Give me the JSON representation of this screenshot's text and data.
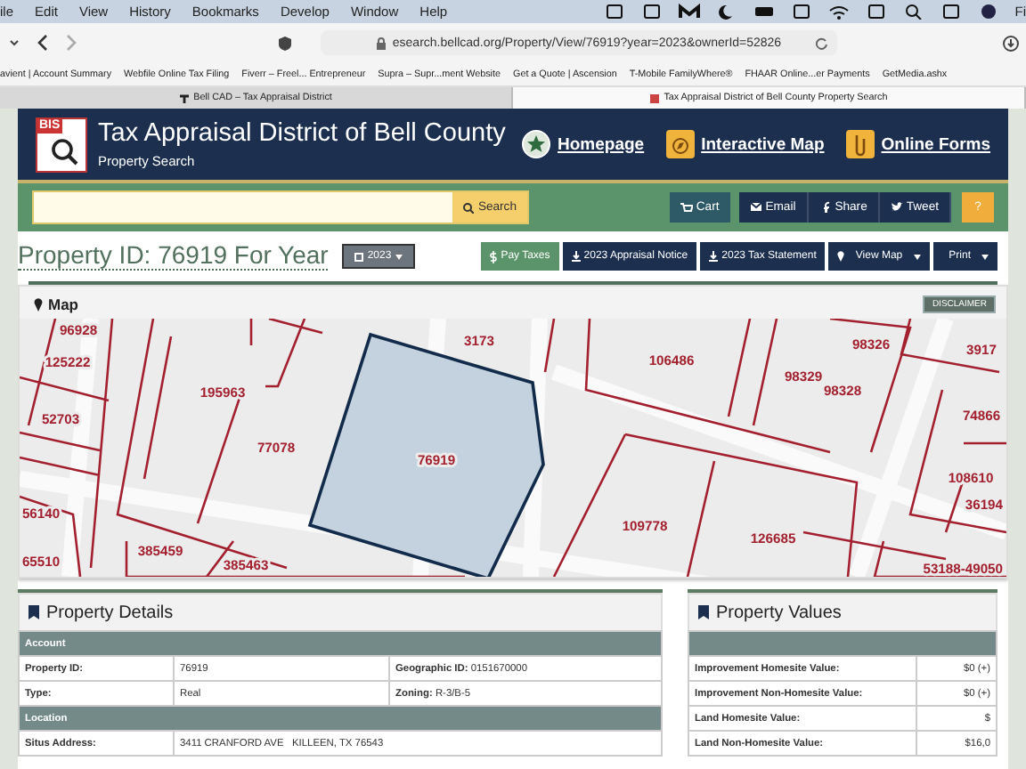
{
  "menu_bar": {
    "items": [
      "ile",
      "Edit",
      "View",
      "History",
      "Bookmarks",
      "Develop",
      "Window",
      "Help"
    ],
    "cut_item": "Fi"
  },
  "toolbar": {
    "address": "esearch.bellcad.org/Property/View/76919?year=2023&ownerId=52826"
  },
  "bookmarks": [
    "avient | Account Summary",
    "Webfile Online Tax Filing",
    "Fiverr – Freel... Entrepreneur",
    "Supra – Supr...ment Website",
    "Get a Quote | Ascension",
    "T-Mobile FamilyWhere®",
    "FHAAR Online...er Payments",
    "GetMedia.ashx"
  ],
  "tabs": [
    {
      "label": "Bell CAD – Tax Appraisal District",
      "selected": false
    },
    {
      "label": "Tax Appraisal District of Bell County Property Search",
      "selected": true
    }
  ],
  "header": {
    "logo": "BIS",
    "title": "Tax Appraisal District of Bell County",
    "subtitle": "Property Search",
    "links": [
      "Homepage",
      "Interactive Map",
      "Online Forms"
    ]
  },
  "search_bar": {
    "button": "Search",
    "cart": "Cart",
    "share_buttons": [
      "Email",
      "Share",
      "Tweet"
    ],
    "help": "?"
  },
  "property": {
    "title": "Property ID: 76919 For Year",
    "year": "2023",
    "buttons": [
      {
        "kind": "pay",
        "label": "Pay Taxes"
      },
      {
        "kind": "download",
        "label": "2023 Appraisal Notice"
      },
      {
        "kind": "download",
        "label": "2023 Tax Statement"
      },
      {
        "kind": "menu",
        "label": "View Map"
      },
      {
        "kind": "menu",
        "label": "Print"
      }
    ]
  },
  "map": {
    "title": "Map",
    "disclaimer": "DISCLAIMER",
    "selected_parcel": "76919",
    "parcels": [
      "96928",
      "125222",
      "52703",
      "195963",
      "77078",
      "3173",
      "106486",
      "98326",
      "98329",
      "98328",
      "3917",
      "74866",
      "108610",
      "36194",
      "56140",
      "65510",
      "385459",
      "385463",
      "109778",
      "126685",
      "53188-49050"
    ]
  },
  "details": {
    "title": "Property Details",
    "sections": [
      {
        "heading": "Account",
        "rows": [
          {
            "kind": "triple",
            "label": "Property ID:",
            "value": "76919",
            "extra": "**Geographic ID:** 0151670000"
          },
          {
            "kind": "triple",
            "label": "Type:",
            "value": "Real",
            "extra": "**Zoning:** R-3/B-5"
          }
        ]
      },
      {
        "heading": "Location",
        "rows": [
          {
            "kind": "wide",
            "label": "Situs Address:",
            "value": "3411 CRANFORD AVE   KILLEEN, TX 76543"
          }
        ]
      }
    ]
  },
  "values": {
    "title": "Property Values",
    "rows": [
      {
        "label": "Improvement Homesite Value:",
        "value": "$0 (+)"
      },
      {
        "label": "Improvement Non-Homesite Value:",
        "value": "$0 (+)"
      },
      {
        "label": "Land Homesite Value:",
        "value": "$"
      },
      {
        "label": "Land Non-Homesite Value:",
        "value": "$16,0"
      }
    ]
  }
}
